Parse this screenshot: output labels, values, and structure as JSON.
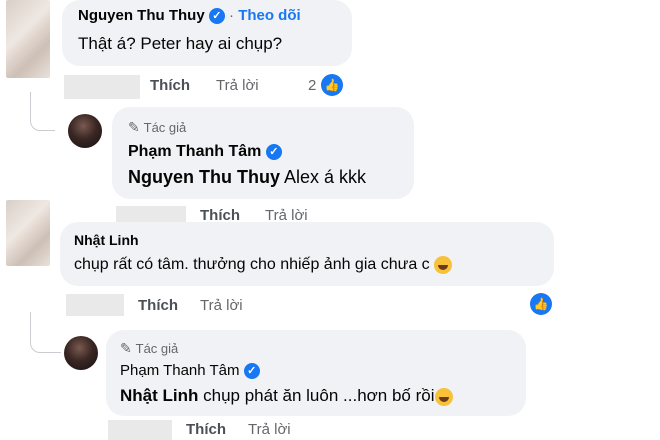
{
  "comment1": {
    "name": "Nguyen Thu Thuy",
    "follow": "Theo dõi",
    "text": "Thật á? Peter hay ai chụp?",
    "like_label": "Thích",
    "reply_label": "Trả lời",
    "reaction_count": "2"
  },
  "reply1": {
    "author_badge": "Tác giả",
    "name": "Phạm Thanh Tâm",
    "mention": "Nguyen Thu Thuy",
    "text": "Alex á kkk",
    "like_label": "Thích",
    "reply_label": "Trả lời"
  },
  "comment2": {
    "name": "Nhật Linh",
    "text": "chụp rất có tâm. thưởng cho nhiếp ảnh gia chưa c",
    "like_label": "Thích",
    "reply_label": "Trả lời"
  },
  "reply2": {
    "author_badge": "Tác giả",
    "name": "Phạm Thanh Tâm",
    "mention": "Nhật Linh",
    "text": "chụp phát ăn luôn ...hơn bố rồi",
    "like_label": "Thích",
    "reply_label": "Trả lời"
  },
  "icons": {
    "verified": "verified-badge-icon",
    "author": "pen-icon",
    "like_reaction": "like-reaction-icon",
    "laugh": "laughing-emoji-icon"
  },
  "colors": {
    "bubble": "#f0f2f5",
    "accent": "#1877f2",
    "muted": "#65676b"
  }
}
